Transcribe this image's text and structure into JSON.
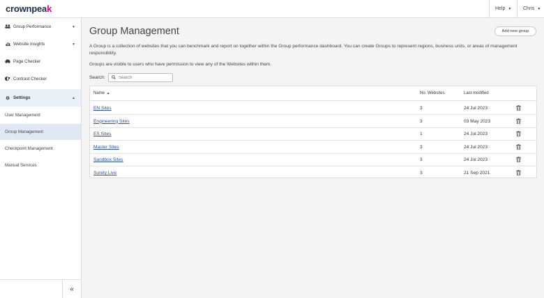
{
  "header": {
    "logo_text": "crownpeak",
    "help_label": "Help",
    "user_label": "Chris"
  },
  "sidebar": {
    "items": [
      {
        "label": "Group Performance",
        "icon": "people-icon"
      },
      {
        "label": "Website Insights",
        "icon": "bar-chart-icon"
      },
      {
        "label": "Page Checker",
        "icon": "car-icon"
      },
      {
        "label": "Contrast Checker",
        "icon": "contrast-icon"
      },
      {
        "label": "Settings",
        "icon": "gear-icon"
      }
    ],
    "sub_items": [
      {
        "label": "User Management"
      },
      {
        "label": "Group Management"
      },
      {
        "label": "Checkpoint Management"
      },
      {
        "label": "Manual Services"
      }
    ],
    "collapse_glyph": "«"
  },
  "main": {
    "title": "Group Management",
    "add_button": "Add new group",
    "description_1": "A Group is a collection of websites that you can benchmark and report on together within the Group performance dashboard. You can create Groups to represent regions, business units, or areas of management responsibility.",
    "description_2": "Groups are visible to users who have permission to view any of the Websites within them.",
    "search_label": "Search:",
    "search_placeholder": "Search"
  },
  "table": {
    "columns": {
      "name": "Name",
      "count": "No. Websites",
      "date": "Last modified"
    },
    "rows": [
      {
        "name": "EN Sites",
        "count": "3",
        "date": "24 Jul 2023"
      },
      {
        "name": "Engineering Sites",
        "count": "3",
        "date": "03 May 2023"
      },
      {
        "name": "ES Sites",
        "count": "1",
        "date": "24 Jul 2023"
      },
      {
        "name": "Master Sites",
        "count": "3",
        "date": "24 Jul 2023"
      },
      {
        "name": "Sandbox Sites",
        "count": "3",
        "date": "24 Jul 2023"
      },
      {
        "name": "Surety Live",
        "count": "3",
        "date": "21 Sep 2021"
      }
    ]
  }
}
